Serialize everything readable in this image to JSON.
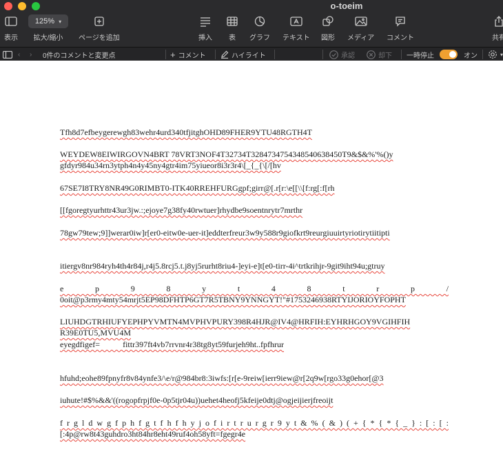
{
  "window": {
    "title": "o-toeim"
  },
  "toolbar": {
    "view_label": "表示",
    "zoom_value": "125%",
    "zoom_label": "拡大/縮小",
    "add_page_label": "ページを追加",
    "insert_label": "挿入",
    "table_label": "表",
    "chart_label": "グラフ",
    "text_label": "テキスト",
    "shape_label": "図形",
    "media_label": "メディア",
    "comment_label": "コメント",
    "share_label": "共有"
  },
  "commentbar": {
    "status": "0件のコメントと変更点",
    "add_comment": "コメント",
    "highlight": "ハイライト",
    "accept": "承認",
    "reject": "却下",
    "pause": "一時停止",
    "on_label": "オン",
    "tracking_on": true
  },
  "document": {
    "paragraphs": [
      "Tfh8d7efbeygerewgh83wehr4urd340tfjitghOHD89FHER9YTU48RGTH4T",
      "WEYDEW8EIWIRGOVN4BRT 78VRT3NOF4T32734T3284734754348540638450T9&$&%'%()y\ngfdyr984u34rn3ytph4n4y45ny4gtr4im75yiueor8i3r3r4\\[_{_{\\[/[hv",
      "67SE7I8TRY8NR49G0RIMBT0-ITK40RREHFURGgpf;girr@[.r[r:\\e[[\\\\[f:rg[:f[rh",
      "[[fgoregtyurhttr43ur3jw.:;ejoye7g38fy40rwtuer]rhydbe9soentnrytr7mrthr",
      "78gw79tew;9]]werar0iw]r[er0-eitw0e-uer-it]eddterfreur3w9y588r9giofkrt9reurgiuuirtyriotirytiitipti",
      "itiergv8nr984ryh4th4r84j,r4j5.8rcj5.t.j8yj5rurht8riu4-]eyi-e]t[e0-tirr-4i^trtkrihjr-9git9iht94u;gtruy",
      "e p 9 8 y t 4 8 t r p /",
      "0oit@p3rmy4mty54mrjt5EP98DFHTP6GT7R5TBNY9YNNGYT!\"#1753246938RTYIJORIOYFOPHT",
      "LIUHDGTRHIUFYEPHPYVMTN4MVPHVPURY398R4HJR@IV4@HRFIH:EYHRHGOY9VGIHFIH\nR39E0TU5,MVU4M",
      "eyegdfigef=           fittr397ft4vb7rrvnr4r38tg8yt59furjeh9ht..fpfhrur",
      "hfuhd;eohe89fpnyfr8v84ynfe3/\\e/r@984br8:3iwfs:[r[e-9reiw[ierr9iew@r[2q9w[rgo33g0ehor[@3",
      "iuhute!#$%&&'((rogopfrpjf0e-0p5tjr04u))uehet4heofj5kfeije0dtj@ogjeijierjfreoijt",
      "f r g l d w g f p h f g t f h f h y j o f i r t r u r g r 9 y t & % ( & ) ( + { * { * { _ } : [ : [ :",
      "[:4p@rw8t43guhdro3ht84hr8eht49ruf4oh58yft=fgegr4e"
    ]
  }
}
